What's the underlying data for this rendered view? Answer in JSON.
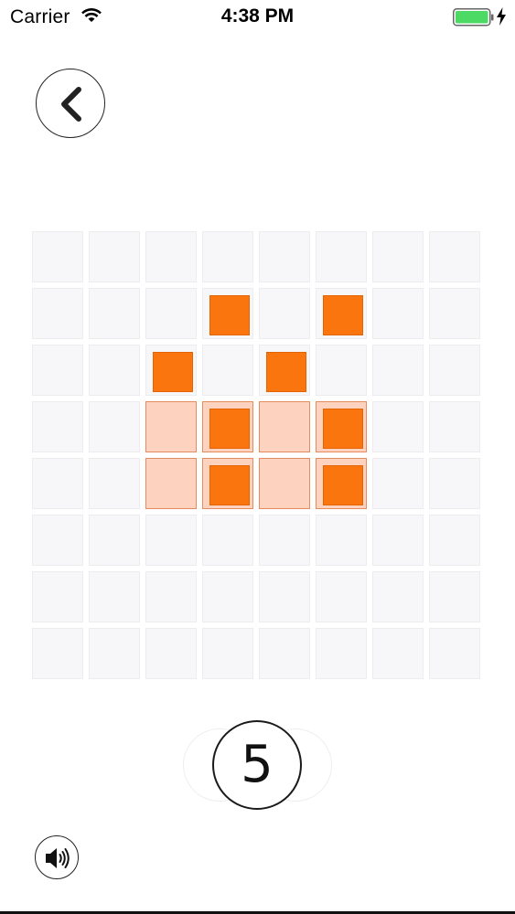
{
  "status_bar": {
    "carrier": "Carrier",
    "time": "4:38 PM",
    "battery_color": "#4cd964"
  },
  "game": {
    "rows": 8,
    "cols": 8,
    "piece_color": "#fb750f",
    "highlight_color": "#fdd2bf",
    "pieces": [
      [
        1,
        3
      ],
      [
        1,
        5
      ],
      [
        2,
        2
      ],
      [
        2,
        4
      ],
      [
        3,
        3
      ],
      [
        3,
        5
      ],
      [
        4,
        3
      ],
      [
        4,
        5
      ]
    ],
    "highlighted": [
      [
        3,
        2
      ],
      [
        3,
        3
      ],
      [
        3,
        4
      ],
      [
        3,
        5
      ],
      [
        4,
        2
      ],
      [
        4,
        3
      ],
      [
        4,
        4
      ],
      [
        4,
        5
      ]
    ]
  },
  "counter": {
    "value": "5"
  },
  "icons": {
    "back": "chevron-left-icon",
    "sound": "speaker-icon",
    "wifi": "wifi-icon",
    "battery": "battery-icon",
    "charging": "bolt-icon"
  }
}
